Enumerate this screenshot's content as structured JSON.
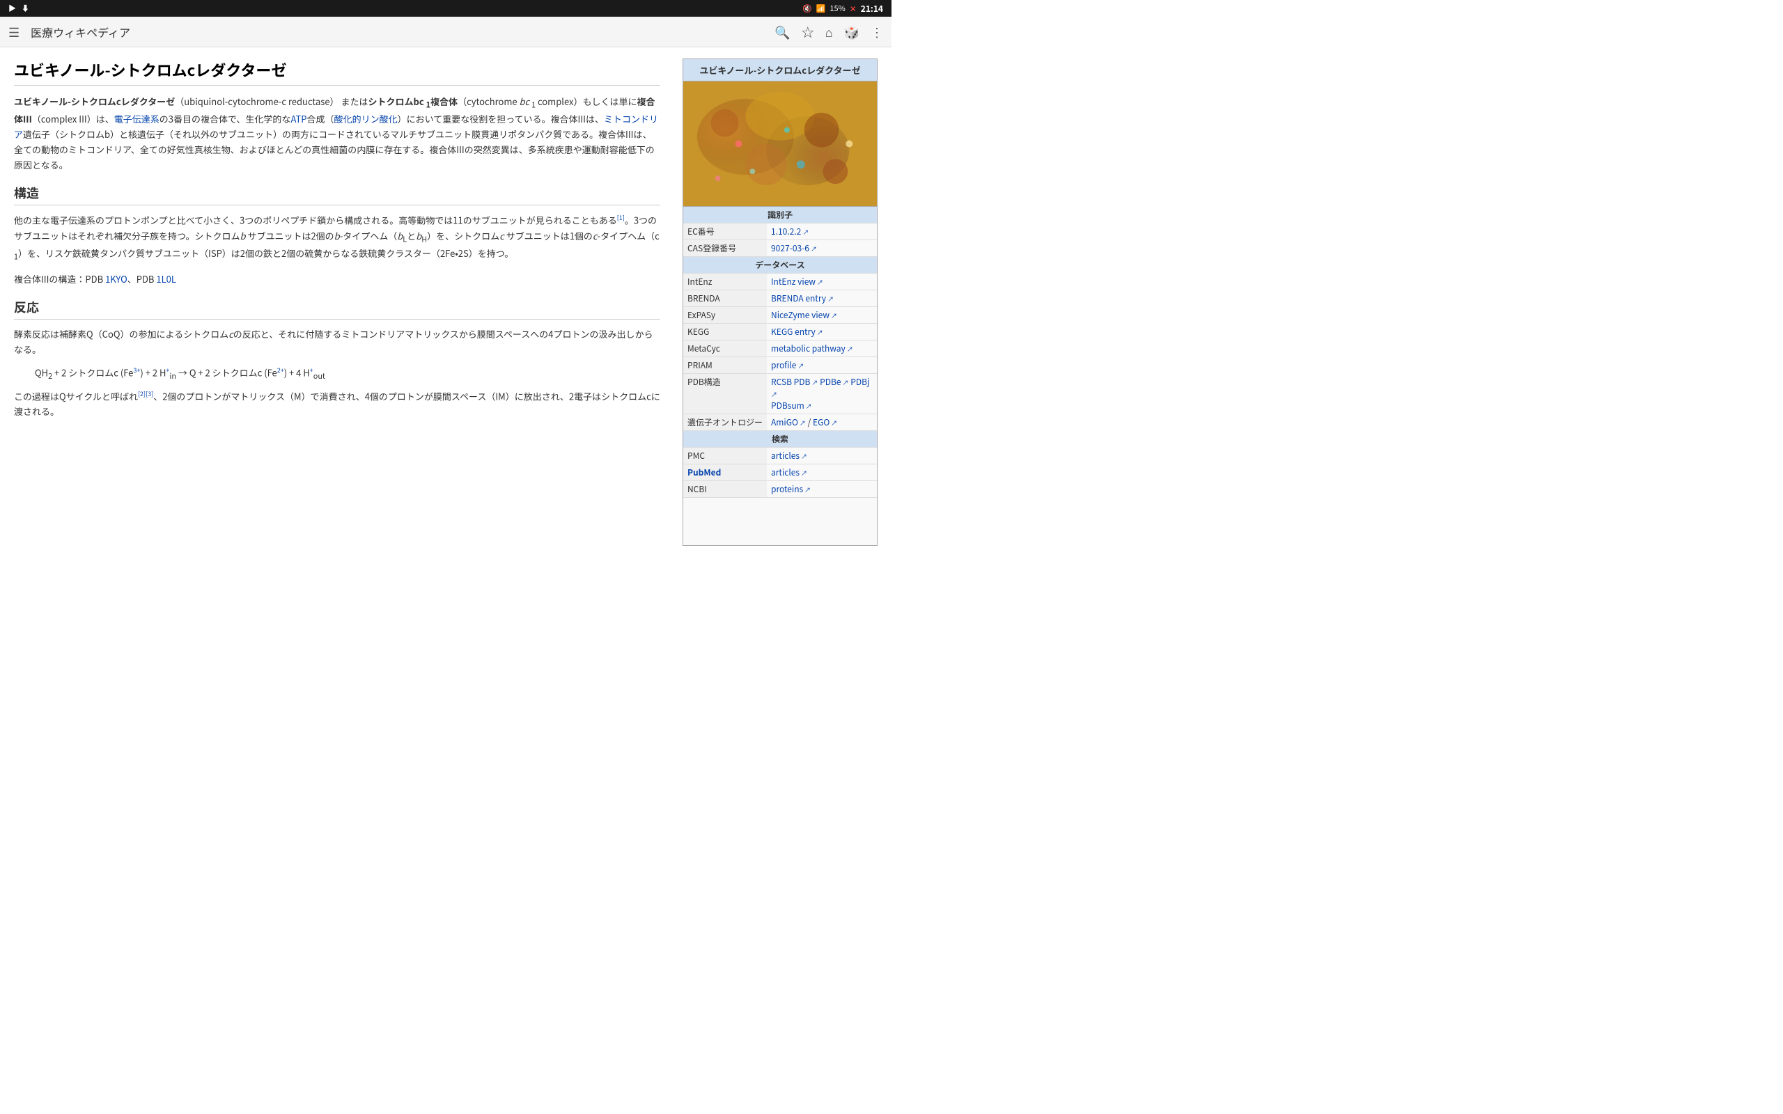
{
  "statusBar": {
    "leftIcons": [
      "▶",
      "⬇"
    ],
    "mute": "🔇",
    "wifi": "WiFi",
    "battery": "15%",
    "batteryAlert": "!",
    "time": "21:14"
  },
  "navBar": {
    "menuIcon": "☰",
    "title": "医療ウィキペディア",
    "searchIcon": "🔍",
    "starIcon": "☆",
    "homeIcon": "⌂",
    "diceIcon": "⚄",
    "moreIcon": "⋮"
  },
  "article": {
    "title": "ユビキノール-シトクロムcレダクターゼ",
    "intro": "ユビキノール-シトクロムcレダクターゼ（ubiquinol-cytochrome-c reductase）またはシトクロムbc₁複合体（cytochrome bc₁ complex）もしくは単に複合体III（complex III）は、電子伝達系の3番目の複合体で、生化学的なATP合成（酸化的リン酸化）において重要な役割を担っている。複合体IIIは、ミトコンドリア遺伝子（シトクロムb）と核遺伝子（それ以外のサブユニット）の両方にコードされているマルチサブユニット膜貫通リポタンパク質である。複合体IIIは、全ての動物のミトコンドリア、全ての好気性真核生物、およびほとんどの真性細菌の内膜に存在する。複合体IIIの突然変異は、多系統疾患や運動耐容能低下の原因となる。",
    "sections": [
      {
        "heading": "構造",
        "content": "他の主な電子伝達系のプロトンポンプと比べて小さく、3つのポリペプチド鎖から構成される。高等動物では11のサブユニットが見られることもある[1]。3つのサブユニットはそれぞれ補欠分子族を持つ。シトクロムb サブユニットは2個のb-タイプヘム（bLとbH）を、シトクロムc サブユニットは1個のc-タイプヘム（c₁）を、リスケ鉄硫黄タンパク質サブユニット（ISP）は2個の鉄と2個の硫黄からなる鉄硫黄クラスター（2Fe•2S）を持つ。",
        "extra": "複合体IIIの構造：PDB 1KYO、PDB 1L0L"
      },
      {
        "heading": "反応",
        "content": "酵素反応は補酵素Q（CoQ）の参加によるシトクロムcの反応と、それに付随するミトコンドリアマトリックスから膜間スペースへの4プロトンの汲み出しからなる。",
        "formula": "QH₂ + 2 シトクロムc (Fe³⁺) + 2 H⁺ᵢₙ → Q + 2 シトクロムc (Fe²⁺) + 4 H⁺ₒᵤₜ",
        "extra2": "この過程はQサイクルと呼ばれ[2][3]、2個のプロトンがマトリックス（M）で消費され、4個のプロトンが膜間スペース（IM）に放出され、2電子はシトクロムcに渡される。"
      }
    ]
  },
  "infobox": {
    "title": "ユビキノール-シトクロムcレダクターゼ",
    "imageAlt": "Protein structure image",
    "identifiers": {
      "sectionLabel": "識別子",
      "ec": {
        "label": "EC番号",
        "value": "1.10.2.2",
        "link": true
      },
      "cas": {
        "label": "CAS登録番号",
        "value": "9027-03-6",
        "link": true
      }
    },
    "databases": {
      "sectionLabel": "データベース",
      "items": [
        {
          "label": "IntEnz",
          "value": "IntEnz view",
          "link": true
        },
        {
          "label": "BRENDA",
          "value": "BRENDA entry",
          "link": true
        },
        {
          "label": "ExPASy",
          "value": "NiceZyme view",
          "link": true
        },
        {
          "label": "KEGG",
          "value": "KEGG entry",
          "link": true
        },
        {
          "label": "MetaCyc",
          "value": "metabolic pathway",
          "link": true
        },
        {
          "label": "PRIAM",
          "value": "profile",
          "link": true
        },
        {
          "label": "PDB構造",
          "value": "RCSB PDB / PDBe / PDBj / PDBsum",
          "link": true
        }
      ]
    },
    "geneOntology": {
      "label": "遺伝子オントロジー",
      "values": [
        {
          "text": "AmiGO",
          "link": true
        },
        {
          "text": "EGO",
          "link": true
        }
      ]
    },
    "search": {
      "sectionLabel": "検索",
      "items": [
        {
          "label": "PMC",
          "value": "articles",
          "link": true
        },
        {
          "label": "PubMed",
          "value": "articles",
          "link": true
        },
        {
          "label": "NCBI",
          "value": "proteins",
          "link": true
        }
      ]
    }
  }
}
